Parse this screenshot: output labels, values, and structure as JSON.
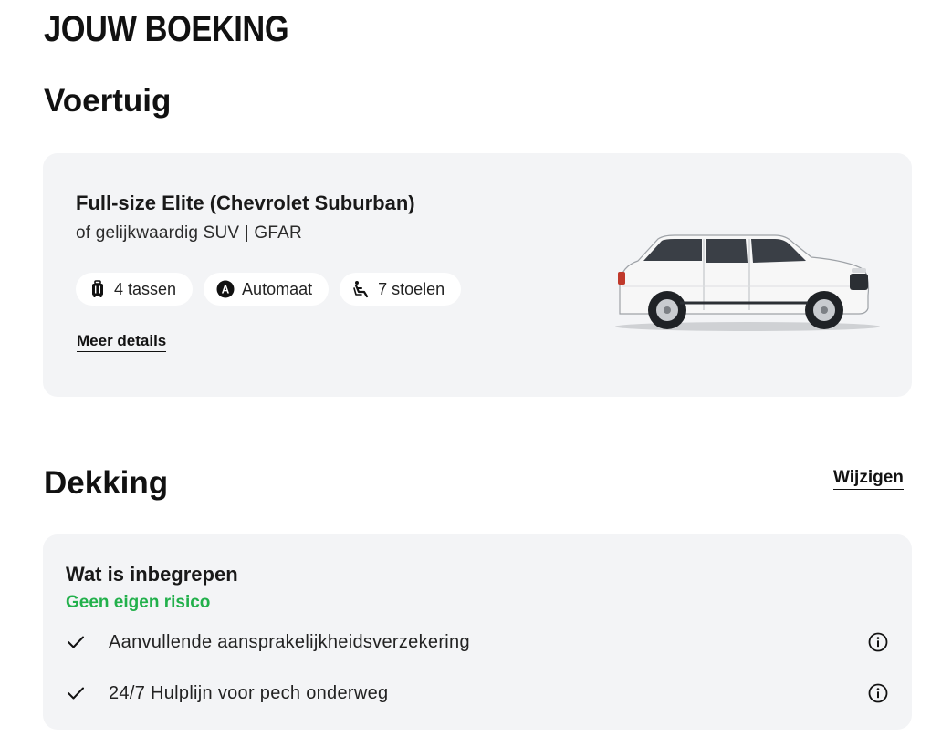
{
  "page": {
    "title": "JOUW BOEKING"
  },
  "vehicle": {
    "heading": "Voertuig",
    "name": "Full-size Elite (Chevrolet Suburban)",
    "subtitle": "of gelijkwaardig SUV | GFAR",
    "features": [
      {
        "icon": "luggage-icon",
        "label": "4 tassen"
      },
      {
        "icon": "automatic-transmission-icon",
        "label": "Automaat"
      },
      {
        "icon": "seat-icon",
        "label": "7 stoelen"
      }
    ],
    "more_details_label": "Meer details",
    "image": "white-suv-image"
  },
  "coverage": {
    "heading": "Dekking",
    "change_label": "Wijzigen",
    "included_title": "Wat is inbegrepen",
    "no_risk_label": "Geen eigen risico",
    "no_risk_color": "#22b04b",
    "items": [
      {
        "label": "Aanvullende aansprakelijkheidsverzekering",
        "icon": "check-icon",
        "info_icon": "info-icon"
      },
      {
        "label": "24/7 Hulplijn voor pech onderweg",
        "icon": "check-icon",
        "info_icon": "info-icon"
      }
    ]
  },
  "colors": {
    "card_background": "#f3f4f6",
    "text": "#191919"
  }
}
